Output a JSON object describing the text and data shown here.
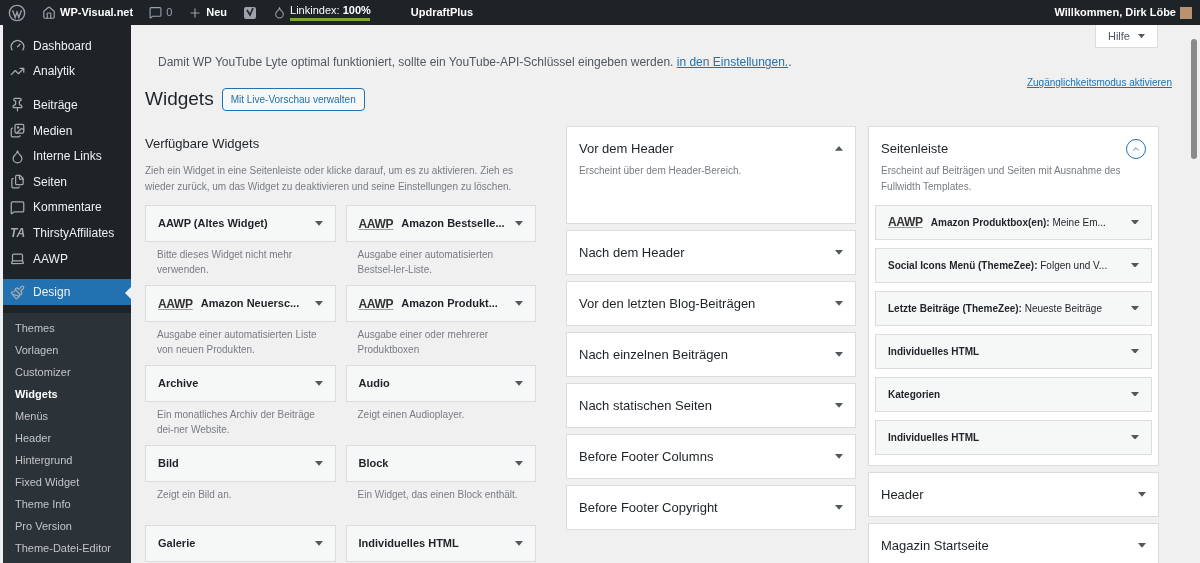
{
  "admin_bar": {
    "site": "WP-Visual.net",
    "comments": "0",
    "new": "Neu",
    "linkindex_label": "Linkindex:",
    "linkindex_value": "100%",
    "level": 1,
    "plugin": "UpdraftPlus",
    "greeting": "Willkommen, Dirk Löbe"
  },
  "sidebar": {
    "items": [
      {
        "label": "Dashboard",
        "selected": false
      },
      {
        "label": "Analytik",
        "selected": false
      },
      {
        "label": "Beiträge",
        "selected": false
      },
      {
        "label": "Medien",
        "selected": false
      },
      {
        "label": "Interne Links",
        "selected": false
      },
      {
        "label": "Seiten",
        "selected": false
      },
      {
        "label": "Kommentare",
        "selected": false
      },
      {
        "label": "ThirstyAffiliates",
        "icon_text": "TA",
        "selected": false
      },
      {
        "label": "AAWP",
        "selected": false
      },
      {
        "label": "Design",
        "selected": true
      }
    ],
    "submenu": [
      {
        "label": "Themes",
        "selected": false
      },
      {
        "label": "Vorlagen",
        "selected": false
      },
      {
        "label": "Customizer",
        "selected": false
      },
      {
        "label": "Widgets",
        "selected": true
      },
      {
        "label": "Menüs",
        "selected": false
      },
      {
        "label": "Header",
        "selected": false
      },
      {
        "label": "Hintergrund",
        "selected": false
      },
      {
        "label": "Fixed Widget",
        "selected": false
      },
      {
        "label": "Theme Info",
        "selected": false
      },
      {
        "label": "Pro Version",
        "selected": false
      },
      {
        "label": "Theme-Datei-Editor",
        "selected": false
      }
    ]
  },
  "help_button": "Hilfe",
  "notice": {
    "text": "Damit WP YouTube Lyte optimal funktioniert, sollte ein YouTube-API-Schlüssel eingeben werden.",
    "link": "in den Einstellungen.",
    "after": "."
  },
  "page_title": "Widgets",
  "live_preview_button": "Mit Live-Vorschau verwalten",
  "accessibility_link": "Zugänglichkeitsmodus aktivieren",
  "available": {
    "title": "Verfügbare Widgets",
    "description": "Zieh ein Widget in eine Seitenleiste oder klicke darauf, um es zu aktivieren. Zieh es wieder zurück, um das Widget zu deaktivieren und seine Einstellungen zu löschen.",
    "widgets": [
      {
        "title": "AAWP (Altes Widget)",
        "description": "Bitte dieses Widget nicht mehr verwenden."
      },
      {
        "logo": "AAWP",
        "title": "Amazon Bestselle...",
        "description": "Ausgabe einer automatisierten Bestsel-ler-Liste."
      },
      {
        "logo": "AAWP",
        "title": "Amazon Neuersc...",
        "description": "Ausgabe einer automatisierten Liste von neuen Produkten."
      },
      {
        "logo": "AAWP",
        "title": "Amazon Produkt...",
        "description": "Ausgabe einer oder mehrerer Produktboxen"
      },
      {
        "title": "Archive",
        "description": "Ein monatliches Archiv der Beiträge dei-ner Website."
      },
      {
        "title": "Audio",
        "description": "Zeigt einen Audioplayer."
      },
      {
        "title": "Bild",
        "description": "Zeigt ein Bild an."
      },
      {
        "title": "Block",
        "description": "Ein Widget, das einen Block enthält."
      },
      {
        "title": "Galerie"
      },
      {
        "title": "Individuelles HTML"
      }
    ]
  },
  "areas_middle": [
    {
      "title": "Vor dem Header",
      "expanded": true,
      "description": "Erscheint über dem Header-Bereich."
    },
    {
      "title": "Nach dem Header",
      "expanded": false
    },
    {
      "title": "Vor den letzten Blog-Beiträgen",
      "expanded": false
    },
    {
      "title": "Nach einzelnen Beiträgen",
      "expanded": false
    },
    {
      "title": "Nach statischen Seiten",
      "expanded": false
    },
    {
      "title": "Before Footer Columns",
      "expanded": false
    },
    {
      "title": "Before Footer Copyright",
      "expanded": false
    }
  ],
  "areas_right": [
    {
      "title": "Seitenleiste",
      "expanded": true,
      "description": "Erscheint auf Beiträgen und Seiten mit Ausnahme des Fullwidth Templates.",
      "widgets": [
        {
          "logo": "AAWP",
          "title": "Amazon Produktbox(en):",
          "subtitle": "Meine Em..."
        },
        {
          "title": "Social Icons Menü (ThemeZee):",
          "subtitle": "Folgen und V..."
        },
        {
          "title": "Letzte Beiträge (ThemeZee):",
          "subtitle": "Neueste Beiträge"
        },
        {
          "title": "Individuelles HTML"
        },
        {
          "title": "Kategorien"
        },
        {
          "title": "Individuelles HTML"
        }
      ]
    },
    {
      "title": "Header",
      "expanded": false
    },
    {
      "title": "Magazin Startseite",
      "expanded": false
    }
  ]
}
